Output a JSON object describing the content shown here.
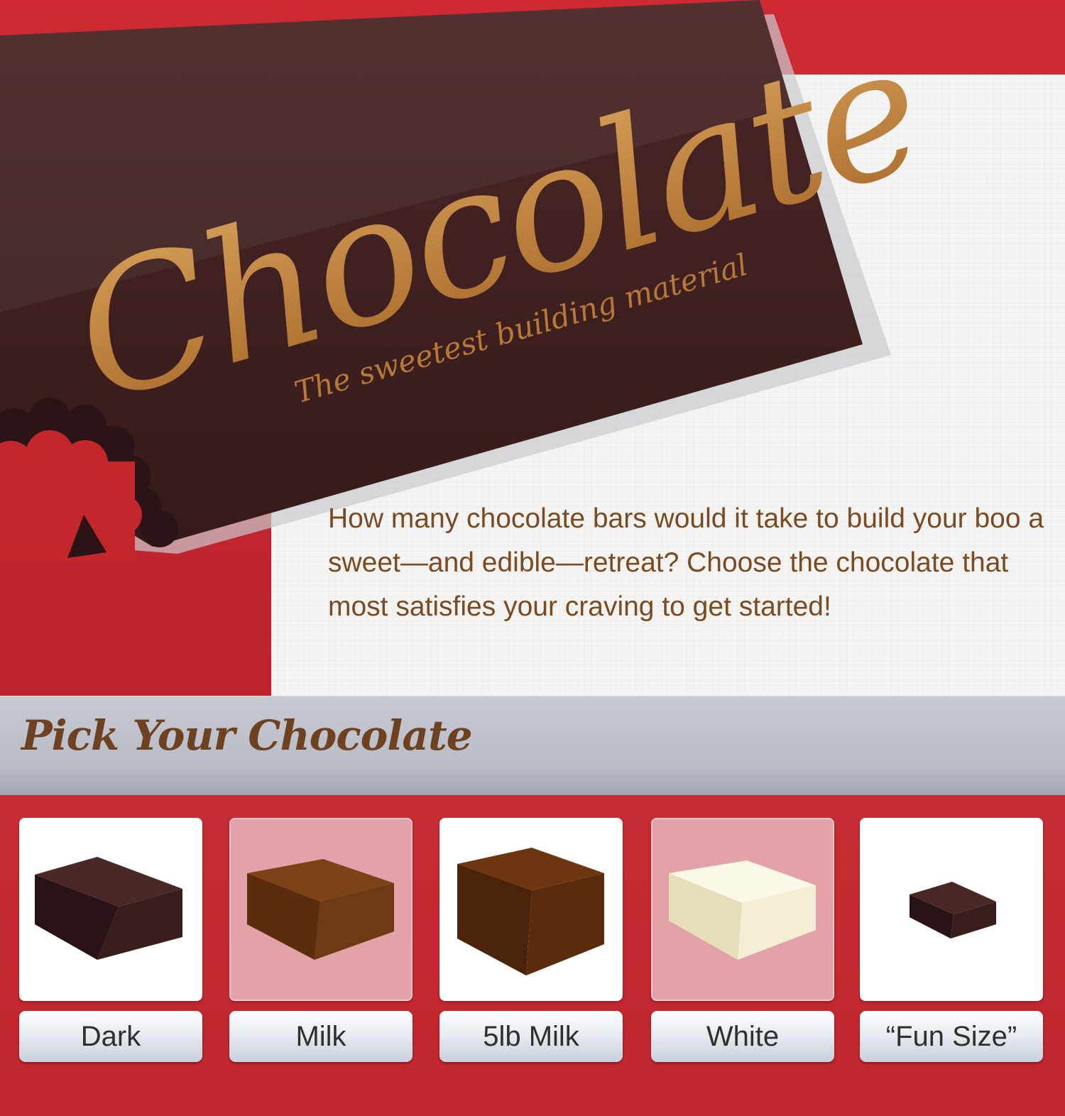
{
  "hero": {
    "title": "Chocolate",
    "subtitle": "The sweetest building material",
    "intro": "How many chocolate bars would it take to build your boo a sweet—and edible—retreat? Choose the chocolate that most satisfies your craving to get started!"
  },
  "section": {
    "title": "Pick Your Chocolate"
  },
  "options": [
    {
      "label": "Dark",
      "color": "#3a1d1d",
      "tile": "white"
    },
    {
      "label": "Milk",
      "color": "#6e3a12",
      "tile": "pink"
    },
    {
      "label": "5lb Milk",
      "color": "#5a2c0c",
      "tile": "white"
    },
    {
      "label": "White",
      "color": "#f3efd5",
      "tile": "pink"
    },
    {
      "label": "“Fun Size”",
      "color": "#3a1d1d",
      "tile": "white"
    }
  ],
  "colors": {
    "background_red": "#c4262e",
    "chocolate_bar": "#3d2020",
    "title_gold": "#b77a36",
    "body_text": "#7a4a22"
  }
}
